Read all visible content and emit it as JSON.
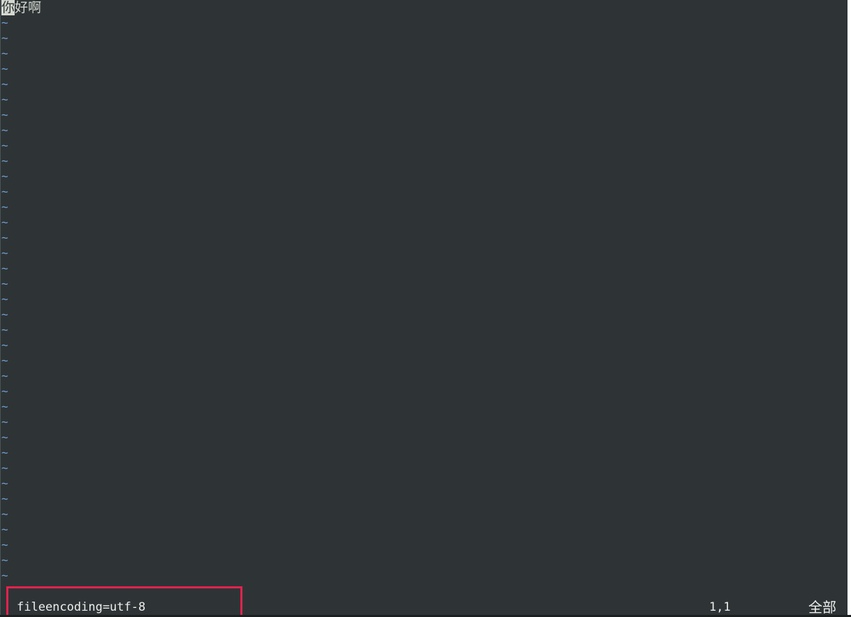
{
  "editor": {
    "buffer_line_1_cursor_char": "你",
    "buffer_line_1_rest": "好啊",
    "empty_line_marker": "~"
  },
  "cmdline": {
    "message": "fileencoding=utf-8",
    "ruler_position": "1,1",
    "ruler_scroll": "全部"
  },
  "colors": {
    "background": "#2e3436",
    "foreground": "#d3d7cf",
    "tilde": "#729fcf",
    "annotation_box": "#e5224e"
  }
}
